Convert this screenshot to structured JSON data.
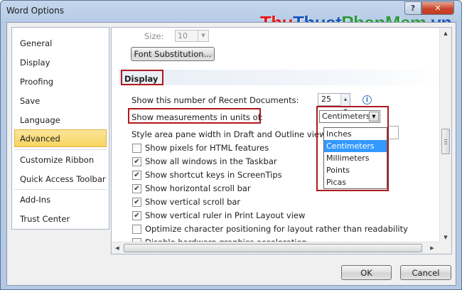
{
  "window": {
    "title": "Word Options"
  },
  "watermark": {
    "part1": "Thu",
    "part2": "Thuat",
    "part3": "PhanMem",
    "part4": ".vn"
  },
  "sidebar": {
    "items": [
      {
        "label": "General"
      },
      {
        "label": "Display"
      },
      {
        "label": "Proofing"
      },
      {
        "label": "Save"
      },
      {
        "label": "Language"
      },
      {
        "label": "Advanced"
      },
      {
        "label": "Customize Ribbon"
      },
      {
        "label": "Quick Access Toolbar"
      },
      {
        "label": "Add-Ins"
      },
      {
        "label": "Trust Center"
      }
    ],
    "active": "Advanced"
  },
  "font": {
    "size_label": "Size:",
    "size_value": "10",
    "substitution_button": "Font Substitution..."
  },
  "display_section": {
    "heading": "Display",
    "recent_docs_label": "Show this number of Recent Documents:",
    "recent_docs_value": "25",
    "measurements_label": "Show measurements in units of:",
    "measurements_value": "Centimeters",
    "style_area_label": "Style area pane width in Draft and Outline views:",
    "unit_options": [
      "Inches",
      "Centimeters",
      "Millimeters",
      "Points",
      "Picas"
    ],
    "unit_selected": "Centimeters",
    "checkboxes": [
      {
        "label": "Show pixels for HTML features",
        "checked": false
      },
      {
        "label": "Show all windows in the Taskbar",
        "checked": true
      },
      {
        "label": "Show shortcut keys in ScreenTips",
        "checked": true
      },
      {
        "label": "Show horizontal scroll bar",
        "checked": true
      },
      {
        "label": "Show vertical scroll bar",
        "checked": true
      },
      {
        "label": "Show vertical ruler in Print Layout view",
        "checked": true
      },
      {
        "label": "Optimize character positioning for layout rather than readability",
        "checked": false
      },
      {
        "label": "Disable hardware graphics acceleration",
        "checked": false
      }
    ]
  },
  "footer": {
    "ok_label": "OK",
    "cancel_label": "Cancel"
  },
  "colors": {
    "highlight_box": "#b0191e",
    "active_nav": "#f7d460",
    "selection": "#3399ff"
  }
}
